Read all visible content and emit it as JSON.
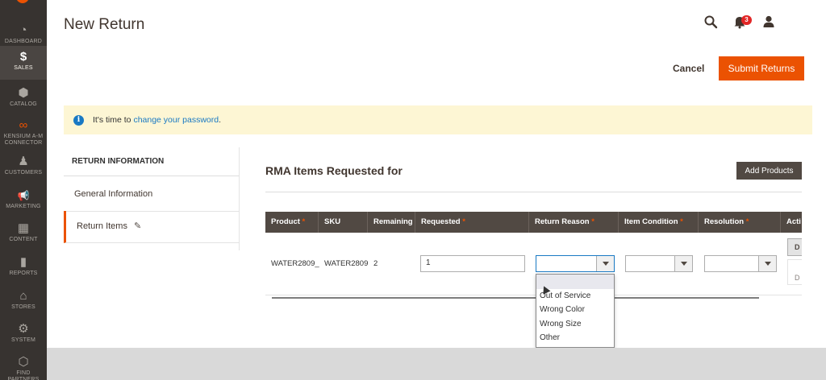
{
  "sidebar": {
    "items": [
      {
        "label": "DASHBOARD",
        "icon": "dashboard-icon",
        "glyph": "◔"
      },
      {
        "label": "SALES",
        "icon": "dollar-icon",
        "glyph": "$",
        "active": true
      },
      {
        "label": "CATALOG",
        "icon": "cube-icon",
        "glyph": "⬢"
      },
      {
        "label": "KENSIUM A-M",
        "label2": "CONNECTOR",
        "icon": "connector-icon",
        "glyph": "∞"
      },
      {
        "label": "CUSTOMERS",
        "icon": "person-icon",
        "glyph": "♟"
      },
      {
        "label": "MARKETING",
        "icon": "megaphone-icon",
        "glyph": "📢"
      },
      {
        "label": "CONTENT",
        "icon": "content-icon",
        "glyph": "▦"
      },
      {
        "label": "REPORTS",
        "icon": "bar-chart-icon",
        "glyph": "▮"
      },
      {
        "label": "STORES",
        "icon": "store-icon",
        "glyph": "⌂"
      },
      {
        "label": "SYSTEM",
        "icon": "gear-icon",
        "glyph": "⚙"
      },
      {
        "label": "FIND PARTNERS",
        "icon": "partners-icon",
        "glyph": "⬡"
      }
    ]
  },
  "header": {
    "title": "New Return",
    "notification_count": "3"
  },
  "actions": {
    "cancel": "Cancel",
    "submit": "Submit Returns"
  },
  "notice": {
    "prefix": "It's time to ",
    "link": "change your password",
    "suffix": "."
  },
  "tabs": {
    "title": "RETURN INFORMATION",
    "items": [
      "General Information",
      "Return Items"
    ]
  },
  "content": {
    "section_title": "RMA Items Requested for",
    "add_products": "Add Products"
  },
  "grid": {
    "headers": [
      {
        "label": "Product",
        "required": true
      },
      {
        "label": "SKU",
        "required": false
      },
      {
        "label": "Remaining",
        "required": false
      },
      {
        "label": "Requested",
        "required": true
      },
      {
        "label": "Return Reason",
        "required": true
      },
      {
        "label": "Item Condition",
        "required": true
      },
      {
        "label": "Resolution",
        "required": true
      },
      {
        "label": "Acti",
        "required": false
      }
    ],
    "row": {
      "product": "WATER2809_",
      "sku": "WATER2809",
      "remaining": "2",
      "requested": "1",
      "return_reason": "",
      "item_condition": "",
      "resolution": "",
      "action1": "D",
      "action2": "D"
    }
  },
  "dropdown": {
    "options": [
      "",
      "Out of Service",
      "Wrong Color",
      "Wrong Size",
      "Other"
    ]
  },
  "colors": {
    "accent": "#eb5202",
    "sidebar": "#373330",
    "grid_header": "#514943",
    "link": "#1979c3"
  }
}
